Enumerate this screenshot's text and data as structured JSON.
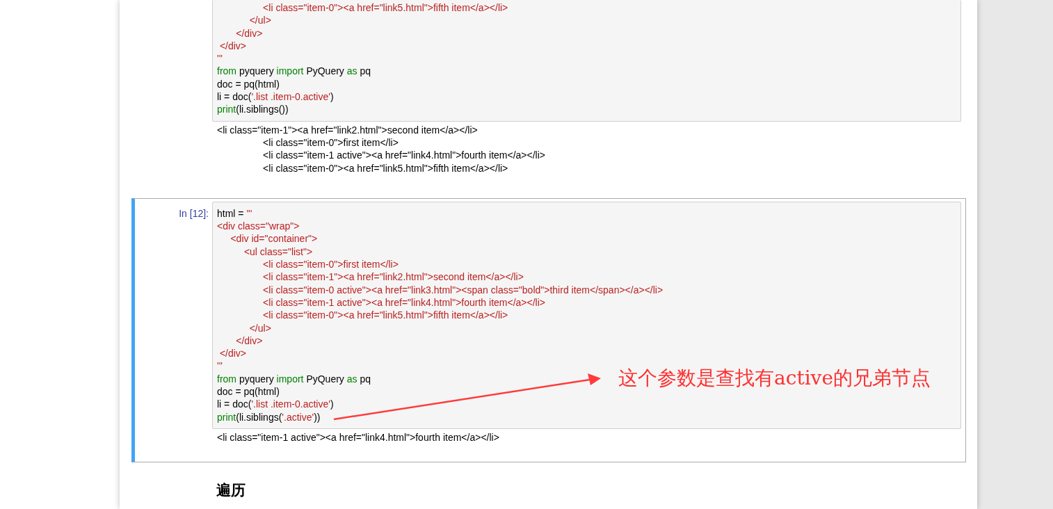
{
  "cells": [
    {
      "selected": false,
      "input_lines": [
        [
          {
            "kind": "string",
            "text": "                 <li class=\"item-0\"><a href=\"link5.html\">fifth item</a></li>"
          }
        ],
        [
          {
            "kind": "string",
            "text": "            </ul>"
          }
        ],
        [
          {
            "kind": "string",
            "text": "       </div>"
          }
        ],
        [
          {
            "kind": "string",
            "text": " </div>"
          }
        ],
        [
          {
            "kind": "string",
            "text": "'''"
          }
        ],
        [
          {
            "kind": "keyword",
            "text": "from"
          },
          {
            "kind": "plain",
            "text": " pyquery "
          },
          {
            "kind": "keyword",
            "text": "import"
          },
          {
            "kind": "plain",
            "text": " PyQuery "
          },
          {
            "kind": "keyword",
            "text": "as"
          },
          {
            "kind": "plain",
            "text": " pq"
          }
        ],
        [
          {
            "kind": "plain",
            "text": "doc = pq(html)"
          }
        ],
        [
          {
            "kind": "plain",
            "text": "li = doc("
          },
          {
            "kind": "string",
            "text": "'.list .item-0.active'"
          },
          {
            "kind": "plain",
            "text": ")"
          }
        ],
        [
          {
            "kind": "keyword",
            "text": "print"
          },
          {
            "kind": "plain",
            "text": "(li.siblings())"
          }
        ]
      ],
      "output_lines": [
        "<li class=\"item-1\"><a href=\"link2.html\">second item</a></li>",
        "                 <li class=\"item-0\">first item</li>",
        "                 <li class=\"item-1 active\"><a href=\"link4.html\">fourth item</a></li>",
        "                 <li class=\"item-0\"><a href=\"link5.html\">fifth item</a></li>"
      ]
    },
    {
      "selected": true,
      "prompt": "In [12]:",
      "input_lines": [
        [
          {
            "kind": "plain",
            "text": "html = "
          },
          {
            "kind": "string",
            "text": "'''"
          }
        ],
        [
          {
            "kind": "string",
            "text": "<div class=\"wrap\">"
          }
        ],
        [
          {
            "kind": "string",
            "text": "     <div id=\"container\">"
          }
        ],
        [
          {
            "kind": "string",
            "text": "          <ul class=\"list\">"
          }
        ],
        [
          {
            "kind": "string",
            "text": "                 <li class=\"item-0\">first item</li>"
          }
        ],
        [
          {
            "kind": "string",
            "text": "                 <li class=\"item-1\"><a href=\"link2.html\">second item</a></li>"
          }
        ],
        [
          {
            "kind": "string",
            "text": "                 <li class=\"item-0 active\"><a href=\"link3.html\"><span class=\"bold\">third item</span></a></li>"
          }
        ],
        [
          {
            "kind": "string",
            "text": "                 <li class=\"item-1 active\"><a href=\"link4.html\">fourth item</a></li>"
          }
        ],
        [
          {
            "kind": "string",
            "text": "                 <li class=\"item-0\"><a href=\"link5.html\">fifth item</a></li>"
          }
        ],
        [
          {
            "kind": "string",
            "text": "            </ul>"
          }
        ],
        [
          {
            "kind": "string",
            "text": "       </div>"
          }
        ],
        [
          {
            "kind": "string",
            "text": " </div>"
          }
        ],
        [
          {
            "kind": "string",
            "text": "'''"
          }
        ],
        [
          {
            "kind": "keyword",
            "text": "from"
          },
          {
            "kind": "plain",
            "text": " pyquery "
          },
          {
            "kind": "keyword",
            "text": "import"
          },
          {
            "kind": "plain",
            "text": " PyQuery "
          },
          {
            "kind": "keyword",
            "text": "as"
          },
          {
            "kind": "plain",
            "text": " pq"
          }
        ],
        [
          {
            "kind": "plain",
            "text": "doc = pq(html)"
          }
        ],
        [
          {
            "kind": "plain",
            "text": "li = doc("
          },
          {
            "kind": "string",
            "text": "'.list .item-0.active'"
          },
          {
            "kind": "plain",
            "text": ")"
          }
        ],
        [
          {
            "kind": "keyword",
            "text": "print"
          },
          {
            "kind": "plain",
            "text": "(li.siblings("
          },
          {
            "kind": "string",
            "text": "'.active'"
          },
          {
            "kind": "plain",
            "text": "))"
          }
        ]
      ],
      "output_lines": [
        "<li class=\"item-1 active\"><a href=\"link4.html\">fourth item</a></li>"
      ]
    }
  ],
  "annotation": {
    "text": "这个参数是查找有active的兄弟节点"
  },
  "heading": "遍历"
}
